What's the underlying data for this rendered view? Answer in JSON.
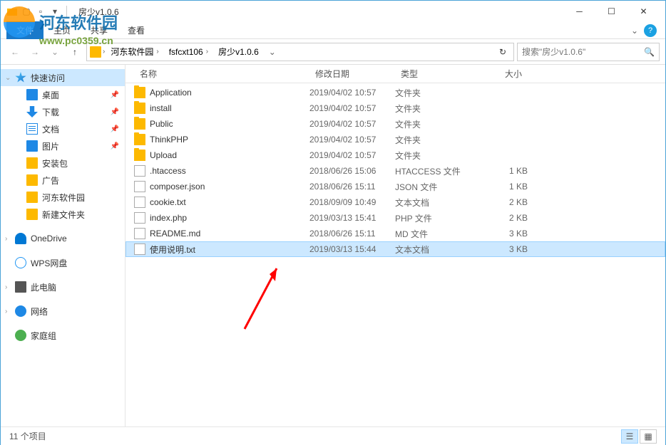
{
  "window": {
    "title": "房少v1.0.6"
  },
  "ribbon": {
    "file": "文件",
    "home": "主页",
    "share": "共享",
    "view": "查看"
  },
  "breadcrumb": {
    "segments": [
      "河东软件园",
      "fsfcxt106",
      "房少v1.0.6"
    ]
  },
  "search": {
    "placeholder": "搜索\"房少v1.0.6\""
  },
  "sidebar": {
    "quickAccess": "快速访问",
    "desktop": "桌面",
    "downloads": "下载",
    "documents": "文档",
    "pictures": "图片",
    "installPkg": "安装包",
    "ads": "广告",
    "hedong": "河东软件园",
    "newFolder": "新建文件夹",
    "oneDrive": "OneDrive",
    "wps": "WPS网盘",
    "thisPc": "此电脑",
    "network": "网络",
    "homegroup": "家庭组"
  },
  "columns": {
    "name": "名称",
    "date": "修改日期",
    "type": "类型",
    "size": "大小"
  },
  "files": [
    {
      "name": "Application",
      "date": "2019/04/02 10:57",
      "type": "文件夹",
      "size": "",
      "icon": "folder"
    },
    {
      "name": "install",
      "date": "2019/04/02 10:57",
      "type": "文件夹",
      "size": "",
      "icon": "folder"
    },
    {
      "name": "Public",
      "date": "2019/04/02 10:57",
      "type": "文件夹",
      "size": "",
      "icon": "folder"
    },
    {
      "name": "ThinkPHP",
      "date": "2019/04/02 10:57",
      "type": "文件夹",
      "size": "",
      "icon": "folder"
    },
    {
      "name": "Upload",
      "date": "2019/04/02 10:57",
      "type": "文件夹",
      "size": "",
      "icon": "folder"
    },
    {
      "name": ".htaccess",
      "date": "2018/06/26 15:06",
      "type": "HTACCESS 文件",
      "size": "1 KB",
      "icon": "file"
    },
    {
      "name": "composer.json",
      "date": "2018/06/26 15:11",
      "type": "JSON 文件",
      "size": "1 KB",
      "icon": "file"
    },
    {
      "name": "cookie.txt",
      "date": "2018/09/09 10:49",
      "type": "文本文档",
      "size": "2 KB",
      "icon": "file"
    },
    {
      "name": "index.php",
      "date": "2019/03/13 15:41",
      "type": "PHP 文件",
      "size": "2 KB",
      "icon": "file"
    },
    {
      "name": "README.md",
      "date": "2018/06/26 15:11",
      "type": "MD 文件",
      "size": "3 KB",
      "icon": "file"
    },
    {
      "name": "使用说明.txt",
      "date": "2019/03/13 15:44",
      "type": "文本文档",
      "size": "3 KB",
      "icon": "file",
      "selected": true
    }
  ],
  "status": {
    "count": "11 个项目"
  },
  "watermark": {
    "text": "河东软件园",
    "url": "www.pc0359.cn"
  }
}
